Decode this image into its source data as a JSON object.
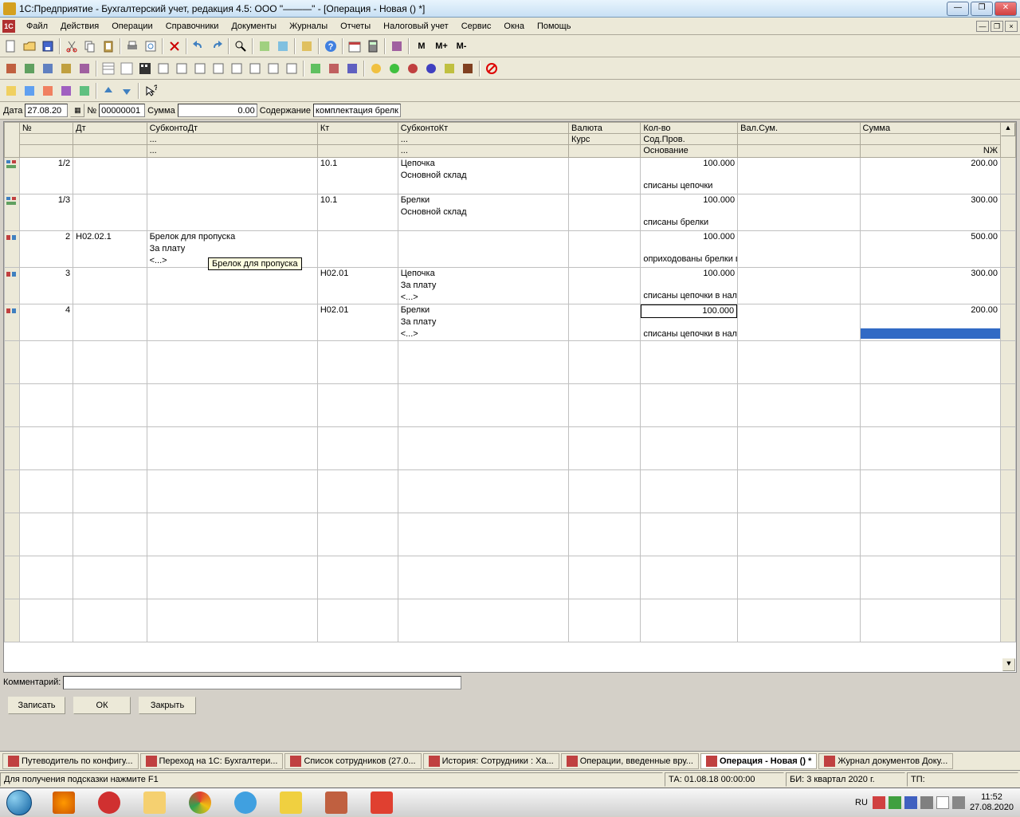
{
  "window": {
    "title": "1С:Предприятие - Бухгалтерский учет, редакция 4.5: ООО \"———\" - [Операция - Новая () *]"
  },
  "menu": [
    "Файл",
    "Действия",
    "Операции",
    "Справочники",
    "Документы",
    "Журналы",
    "Отчеты",
    "Налоговый учет",
    "Сервис",
    "Окна",
    "Помощь"
  ],
  "form": {
    "date_label": "Дата",
    "date_value": "27.08.20",
    "num_label": "№",
    "num_value": "00000001",
    "sum_label": "Сумма",
    "sum_value": "0.00",
    "content_label": "Содержание",
    "content_value": "комплектация брелки"
  },
  "grid": {
    "headers": {
      "num": "№",
      "dt": "Дт",
      "subdt": "СубконтоДт",
      "kt": "Кт",
      "subkt": "СубконтоКт",
      "val": "Валюта",
      "kurs": "Курс",
      "kolvo": "Кол-во",
      "sodprov": "Сод.Пров.",
      "osnov": "Основание",
      "valsum": "Вал.Сум.",
      "summa": "Сумма",
      "nzh": "NЖ"
    },
    "rows": [
      {
        "marker": "split",
        "num": "1/2",
        "dt": "",
        "subdt1": "",
        "subdt2": "",
        "subdt3": "",
        "kt": "10.1",
        "subkt1": "Цепочка",
        "subkt2": "Основной склад",
        "subkt3": "",
        "kolvo": "100.000",
        "sodprov": "",
        "osnov": "списаны цепочки",
        "sum": "200.00",
        "nzh": ""
      },
      {
        "marker": "split",
        "num": "1/3",
        "dt": "",
        "subdt1": "",
        "subdt2": "",
        "subdt3": "",
        "kt": "10.1",
        "subkt1": "Брелки",
        "subkt2": "Основной склад",
        "subkt3": "",
        "kolvo": "100.000",
        "sodprov": "",
        "osnov": "списаны брелки",
        "sum": "300.00",
        "nzh": ""
      },
      {
        "marker": "prov",
        "num": "2",
        "dt": "Н02.02.1",
        "subdt1": "Брелок для пропуска",
        "subdt2": "За плату",
        "subdt3": "<...>",
        "kt": "",
        "subkt1": "",
        "subkt2": "",
        "subkt3": "",
        "kolvo": "100.000",
        "sodprov": "",
        "osnov": "оприходованы брелки в НУ",
        "sum": "500.00",
        "nzh": ""
      },
      {
        "marker": "prov",
        "num": "3",
        "dt": "",
        "subdt1": "",
        "subdt2": "",
        "subdt3": "",
        "kt": "Н02.01",
        "subkt1": "Цепочка",
        "subkt2": "За плату",
        "subkt3": "<...>",
        "kolvo": "100.000",
        "sodprov": "",
        "osnov": "списаны цепочки в налоговом учете",
        "sum": "300.00",
        "nzh": ""
      },
      {
        "marker": "prov",
        "num": "4",
        "dt": "",
        "subdt1": "",
        "subdt2": "",
        "subdt3": "",
        "kt": "Н02.01",
        "subkt1": "Брелки",
        "subkt2": "За плату",
        "subkt3": "<...>",
        "kolvo": "100.000",
        "sodprov": "",
        "osnov": "списаны цепочки в налоговом учете",
        "sum": "200.00",
        "nzh": "",
        "active": true
      }
    ],
    "tooltip": "Брелок для пропуска",
    "ellipsis": "..."
  },
  "comment_label": "Комментарий:",
  "buttons": {
    "save": "Записать",
    "ok": "ОК",
    "close": "Закрыть"
  },
  "wintabs": [
    {
      "label": "Путеводитель по конфигу...",
      "active": false
    },
    {
      "label": "Переход на 1С: Бухгалтери...",
      "active": false
    },
    {
      "label": "Список сотрудников (27.0...",
      "active": false
    },
    {
      "label": "История: Сотрудники : Ха...",
      "active": false
    },
    {
      "label": "Операции, введенные вру...",
      "active": false
    },
    {
      "label": "Операция - Новая () *",
      "active": true
    },
    {
      "label": "Журнал документов  Доку...",
      "active": false
    }
  ],
  "status": {
    "hint": "Для получения подсказки нажмите F1",
    "ta": "ТА: 01.08.18  00:00:00",
    "bi": "БИ: 3 квартал 2020 г.",
    "tp": "ТП:"
  },
  "tray": {
    "lang": "RU",
    "time": "11:52",
    "date": "27.08.2020"
  }
}
